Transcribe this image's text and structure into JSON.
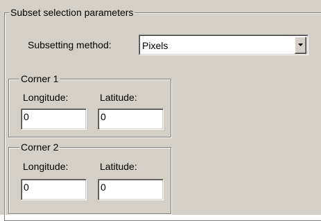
{
  "subset_group": {
    "title": "Subset selection parameters",
    "method_label": "Subsetting method:",
    "method_value": "Pixels"
  },
  "corner1": {
    "title": "Corner 1",
    "longitude_label": "Longitude:",
    "latitude_label": "Latitude:",
    "longitude_value": "0",
    "latitude_value": "0"
  },
  "corner2": {
    "title": "Corner 2",
    "longitude_label": "Longitude:",
    "latitude_label": "Latitude:",
    "longitude_value": "0",
    "latitude_value": "0"
  },
  "icons": {
    "dropdown": "chevron-down-icon"
  }
}
